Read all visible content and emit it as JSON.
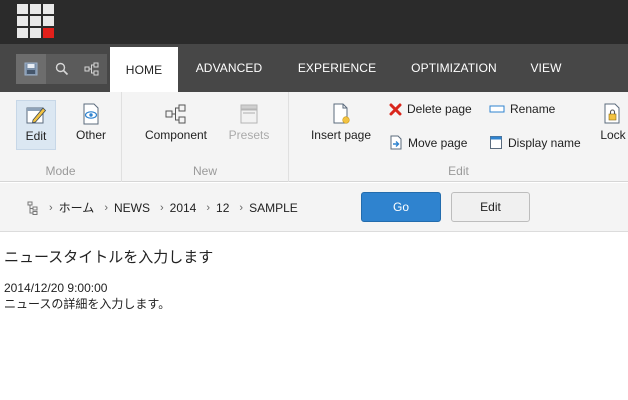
{
  "launchpad": {
    "icon": "launchpad-grid-icon"
  },
  "quick_access": [
    {
      "icon": "save-icon"
    },
    {
      "icon": "search-icon"
    },
    {
      "icon": "tree-icon"
    }
  ],
  "tabs": [
    {
      "label": "HOME",
      "active": true
    },
    {
      "label": "ADVANCED"
    },
    {
      "label": "EXPERIENCE"
    },
    {
      "label": "OPTIMIZATION"
    },
    {
      "label": "VIEW"
    }
  ],
  "ribbon": {
    "mode": {
      "label": "Mode",
      "edit": "Edit",
      "other": "Other"
    },
    "new": {
      "label": "New",
      "component": "Component",
      "presets": "Presets"
    },
    "edit": {
      "label": "Edit",
      "insert_page": "Insert page",
      "delete_page": "Delete page",
      "move_page": "Move page",
      "rename": "Rename",
      "display_name": "Display name",
      "lock": "Lock"
    }
  },
  "breadcrumb": {
    "items": [
      "ホーム",
      "NEWS",
      "2014",
      "12",
      "SAMPLE"
    ]
  },
  "buttons": {
    "go": "Go",
    "edit": "Edit"
  },
  "content": {
    "title": "ニュースタイトルを入力します",
    "date": "2014/12/20 9:00:00",
    "body": "ニュースの詳細を入力します。"
  },
  "colors": {
    "top_bar": "#2b2b2b",
    "tab_strip": "#474747",
    "go_button": "#2f83cf",
    "delete_icon": "#d9261c",
    "launchpad_accent": "#e2201b"
  }
}
